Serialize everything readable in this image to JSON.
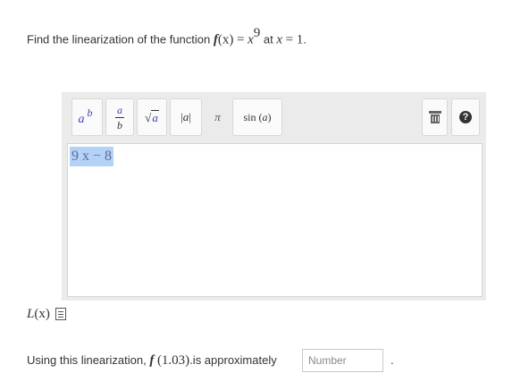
{
  "question": {
    "prefix": "Find the linearization of the function",
    "fn_name": "f",
    "fn_arg": "(x)",
    "equals": "=",
    "base": "x",
    "exponent": "9",
    "at_word": "at",
    "point_var": "x",
    "point_eq": "=",
    "point_val": "1",
    "end": "."
  },
  "toolbar": {
    "power": {
      "base": "a",
      "exp": "b"
    },
    "fraction": {
      "num": "a",
      "den": "b"
    },
    "sqrt": {
      "radical": "√",
      "radicand": "a"
    },
    "abs": {
      "left": "|",
      "inner": "a",
      "right": "|"
    },
    "pi": "π",
    "sin": {
      "fn": "sin",
      "arg": "a"
    },
    "help": "?"
  },
  "editor": {
    "expression": "9 x − 8"
  },
  "answer_label": {
    "fn": "L",
    "arg": "(x)"
  },
  "question2": {
    "prefix": "Using this linearization,",
    "fn_name": "f",
    "arg": "(1.03)",
    "suffix": ".is approximately",
    "input_placeholder": "Number",
    "input_value": "",
    "end": "."
  },
  "colors": {
    "selection": "#b4d2f5",
    "toolbar_bg": "#ebebeb",
    "symbol_accent": "#3a45b8"
  }
}
